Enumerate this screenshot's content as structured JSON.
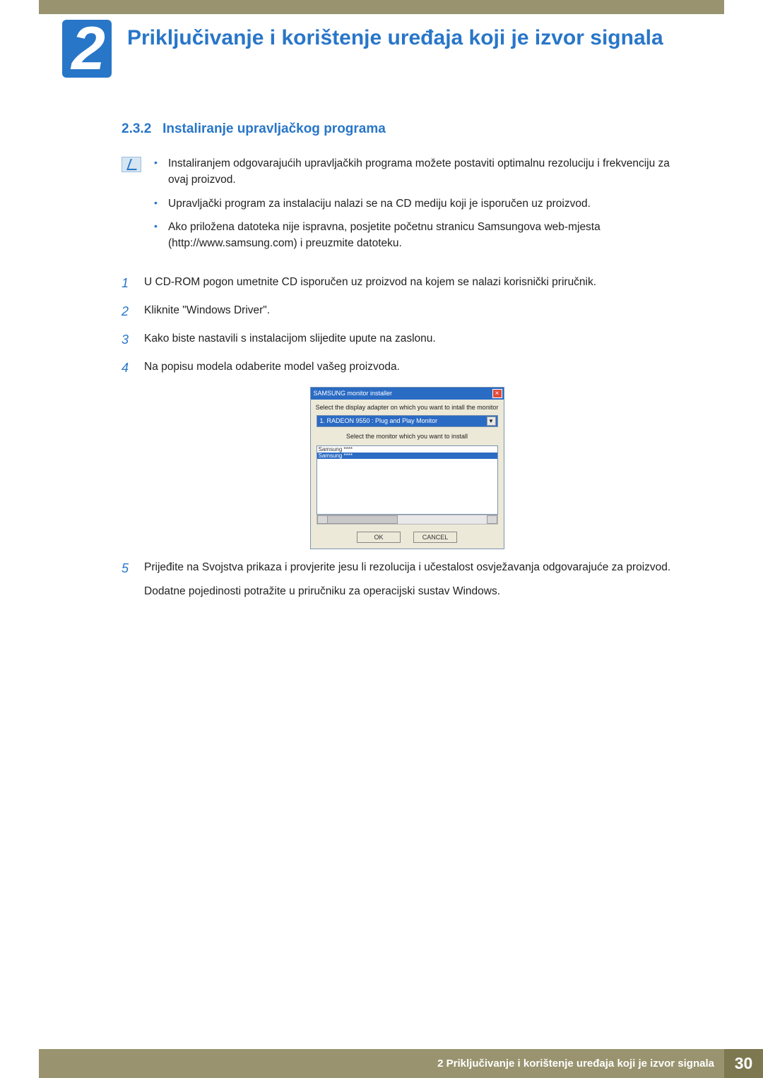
{
  "chapter": {
    "number": "2",
    "title": "Priključivanje i korištenje uređaja koji je izvor signala"
  },
  "section": {
    "number": "2.3.2",
    "title": "Instaliranje upravljačkog programa"
  },
  "notes": [
    "Instaliranjem odgovarajućih upravljačkih programa možete postaviti optimalnu rezoluciju i frekvenciju za ovaj proizvod.",
    "Upravljački program za instalaciju nalazi se na CD mediju koji je isporučen uz proizvod.",
    "Ako priložena datoteka nije ispravna, posjetite početnu stranicu Samsungova web-mjesta (http://www.samsung.com) i preuzmite datoteku."
  ],
  "steps": [
    {
      "n": "1",
      "text": "U CD-ROM pogon umetnite CD isporučen uz proizvod na kojem se nalazi korisnički priručnik."
    },
    {
      "n": "2",
      "text": "Kliknite \"Windows Driver\"."
    },
    {
      "n": "3",
      "text": "Kako biste nastavili s instalacijom slijedite upute na zaslonu."
    },
    {
      "n": "4",
      "text": "Na popisu modela odaberite model vašeg proizvoda."
    },
    {
      "n": "5",
      "text": "Prijeđite na Svojstva prikaza i provjerite jesu li rezolucija i učestalost osvježavanja odgovarajuće za proizvod.",
      "extra": "Dodatne pojedinosti potražite u priručniku za operacijski sustav Windows."
    }
  ],
  "screenshot": {
    "title": "SAMSUNG monitor installer",
    "label1": "Select the display adapter on which you want to intall the monitor",
    "dropdown": "1. RADEON 9550 : Plug and Play Monitor",
    "label2": "Select the monitor which you want to install",
    "list": [
      "Samsung ****",
      "Samsung ****"
    ],
    "ok": "OK",
    "cancel": "CANCEL"
  },
  "footer": {
    "text": "2 Priključivanje i korištenje uređaja koji je izvor signala",
    "page": "30"
  }
}
